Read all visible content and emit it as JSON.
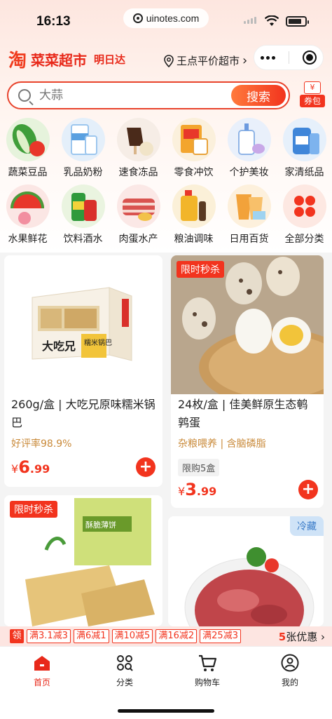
{
  "status": {
    "time": "16:13",
    "url": "uinotes.com"
  },
  "header": {
    "logo": "淘",
    "brand": "菜菜超市",
    "brand_sub": "明日达",
    "store": "王点平价超市",
    "store_chevron": "›"
  },
  "search": {
    "placeholder": "大蒜",
    "button": "搜索",
    "coupon_tag": "¥",
    "coupon_label": "券包"
  },
  "categories": [
    {
      "label": "蔬菜豆品"
    },
    {
      "label": "乳品奶粉"
    },
    {
      "label": "速食冻品"
    },
    {
      "label": "零食冲饮"
    },
    {
      "label": "个护美妆"
    },
    {
      "label": "家清纸品"
    },
    {
      "label": "水果鲜花"
    },
    {
      "label": "饮料酒水"
    },
    {
      "label": "肉蛋水产"
    },
    {
      "label": "粮油调味"
    },
    {
      "label": "日用百货"
    },
    {
      "label": "全部分类"
    }
  ],
  "products": [
    {
      "title": "260g/盒 | 大吃兄原味糯米锅巴",
      "rating": "好评率98.9%",
      "currency": "¥",
      "price_int": "6",
      "price_dec": ".99",
      "package_brand": "大吃兄",
      "package_label": "糯米锅巴",
      "add": "+"
    },
    {
      "tag": "限时秒杀",
      "title": "24枚/盒 | 佳美鲜原生态鹌鹑蛋",
      "sub": "杂粮喂养 | 含脑磷脂",
      "limit": "限购5盒",
      "currency": "¥",
      "price_int": "3",
      "price_dec": ".99",
      "add": "+"
    },
    {
      "tag": "限时秒杀",
      "package_label": "酥脆薄饼"
    },
    {
      "tag": "冷藏"
    }
  ],
  "coupon_strip": {
    "icon": "领",
    "items": [
      "满3.1减3",
      "满6减1",
      "满10减5",
      "满16减2",
      "满25减3"
    ],
    "count": "5",
    "count_suffix": "张优惠",
    "chevron": "›"
  },
  "tabs": [
    {
      "label": "首页",
      "active": true
    },
    {
      "label": "分类"
    },
    {
      "label": "购物车"
    },
    {
      "label": "我的"
    }
  ],
  "colors": {
    "accent": "#f2341e",
    "brand": "#e8291a",
    "cold": "#3a7bc8"
  }
}
